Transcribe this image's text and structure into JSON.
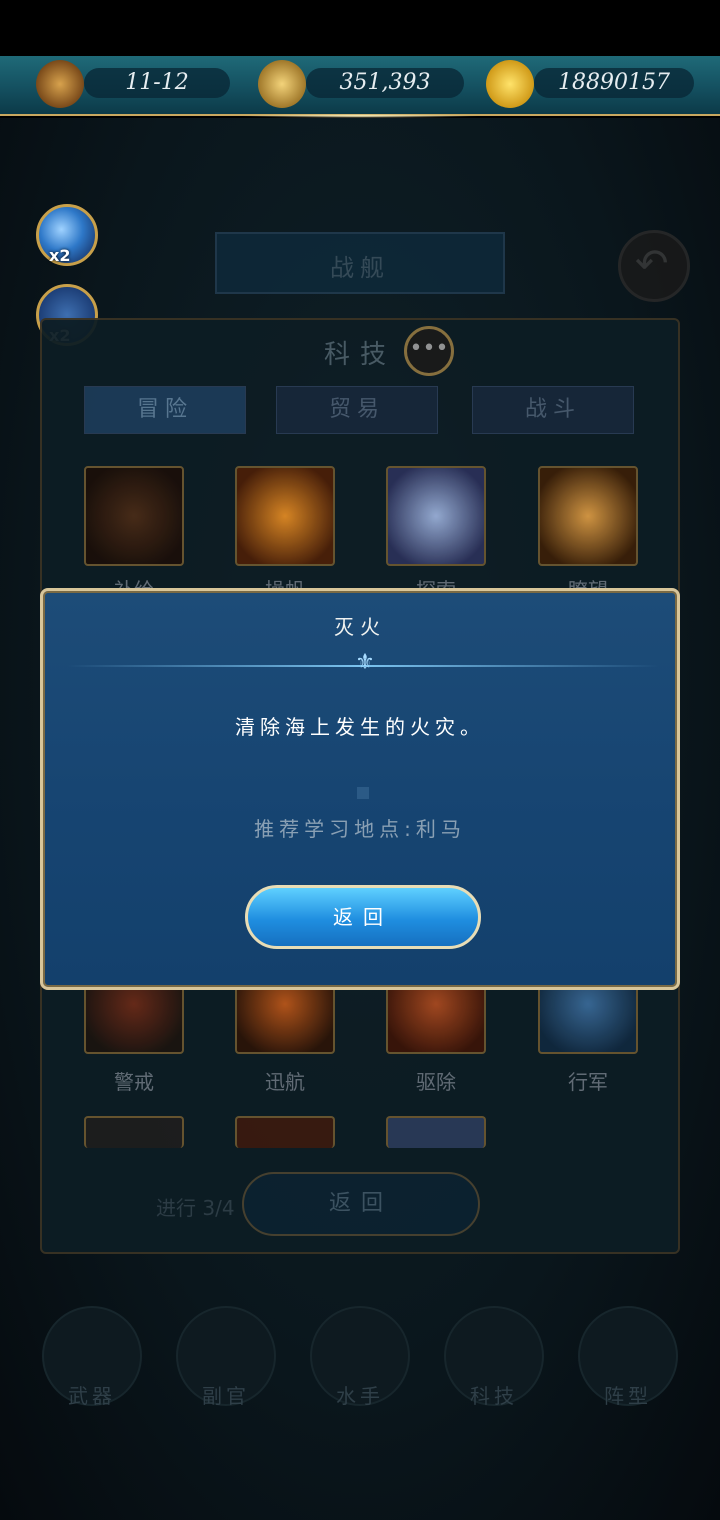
{
  "resources": {
    "time": {
      "icon": "hourglass-icon",
      "value": "11-12"
    },
    "exploration": {
      "icon": "compass-icon",
      "value": "351,393"
    },
    "gold": {
      "icon": "anchor-coin-icon",
      "value": "18890157"
    }
  },
  "boosts": [
    {
      "icon": "magnifier-icon",
      "multiplier": "x2"
    },
    {
      "icon": "crossed-swords-icon",
      "multiplier": "x2"
    }
  ],
  "background": {
    "banner_title": "战舰",
    "panel_title": "科技",
    "tabs": [
      {
        "label": "冒险",
        "active": true
      },
      {
        "label": "贸易",
        "active": false
      },
      {
        "label": "战斗",
        "active": false
      }
    ],
    "skills_row1": [
      {
        "icon": "bottle-icon",
        "label": "补给"
      },
      {
        "icon": "ship-icon",
        "label": "操帆"
      },
      {
        "icon": "book-icon",
        "label": "探索"
      },
      {
        "icon": "spyglass-icon",
        "label": "瞭望"
      }
    ],
    "skills_row4": [
      {
        "icon": "cannon-icon",
        "label": "警戒"
      },
      {
        "icon": "horse-icon",
        "label": "迅航"
      },
      {
        "icon": "rat-icon",
        "label": "驱除"
      },
      {
        "icon": "fleet-icon",
        "label": "行军"
      }
    ],
    "back_label": "返回",
    "progress": "进行 3/4"
  },
  "bottom_nav": [
    {
      "icon": "sword-icon",
      "label": "武器"
    },
    {
      "icon": "helm-icon",
      "label": "副官"
    },
    {
      "icon": "hook-icon",
      "label": "水手"
    },
    {
      "icon": "compass-icon",
      "label": "科技"
    },
    {
      "icon": "flag-icon",
      "label": "阵型"
    }
  ],
  "modal": {
    "title": "灭火",
    "description": "清除海上发生的火灾。",
    "location": "推荐学习地点:利马",
    "back_label": "返回"
  },
  "colors": {
    "accent_gold": "#d8c69a",
    "modal_blue": "#174572",
    "button_blue": "#1f8ee0"
  }
}
